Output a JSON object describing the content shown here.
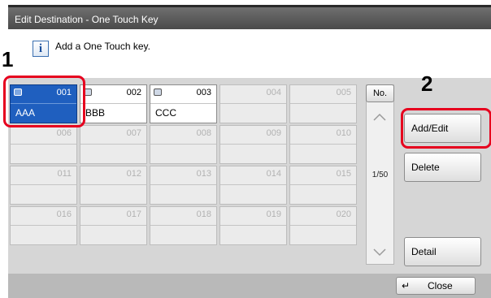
{
  "window": {
    "title": "Edit Destination - One Touch Key"
  },
  "message": {
    "icon": "info-icon",
    "icon_glyph": "i",
    "text": "Add a One Touch key."
  },
  "keys": [
    {
      "number": "001",
      "name": "AAA",
      "filled": true,
      "selected": true
    },
    {
      "number": "002",
      "name": "BBB",
      "filled": true,
      "selected": false
    },
    {
      "number": "003",
      "name": "CCC",
      "filled": true,
      "selected": false
    },
    {
      "number": "004",
      "name": "",
      "filled": false,
      "selected": false
    },
    {
      "number": "005",
      "name": "",
      "filled": false,
      "selected": false
    },
    {
      "number": "006",
      "name": "",
      "filled": false,
      "selected": false
    },
    {
      "number": "007",
      "name": "",
      "filled": false,
      "selected": false
    },
    {
      "number": "008",
      "name": "",
      "filled": false,
      "selected": false
    },
    {
      "number": "009",
      "name": "",
      "filled": false,
      "selected": false
    },
    {
      "number": "010",
      "name": "",
      "filled": false,
      "selected": false
    },
    {
      "number": "011",
      "name": "",
      "filled": false,
      "selected": false
    },
    {
      "number": "012",
      "name": "",
      "filled": false,
      "selected": false
    },
    {
      "number": "013",
      "name": "",
      "filled": false,
      "selected": false
    },
    {
      "number": "014",
      "name": "",
      "filled": false,
      "selected": false
    },
    {
      "number": "015",
      "name": "",
      "filled": false,
      "selected": false
    },
    {
      "number": "016",
      "name": "",
      "filled": false,
      "selected": false
    },
    {
      "number": "017",
      "name": "",
      "filled": false,
      "selected": false
    },
    {
      "number": "018",
      "name": "",
      "filled": false,
      "selected": false
    },
    {
      "number": "019",
      "name": "",
      "filled": false,
      "selected": false
    },
    {
      "number": "020",
      "name": "",
      "filled": false,
      "selected": false
    }
  ],
  "scroll": {
    "sort_label": "No.",
    "page_indicator": "1/50"
  },
  "actions": {
    "add_edit": "Add/Edit",
    "delete": "Delete",
    "detail": "Detail"
  },
  "footer": {
    "close_label": "Close",
    "close_icon_glyph": "↵"
  },
  "callouts": {
    "step1": "1",
    "step2": "2"
  },
  "colors": {
    "selected_key": "#1f5fbf",
    "highlight_outline": "#e6001e"
  }
}
